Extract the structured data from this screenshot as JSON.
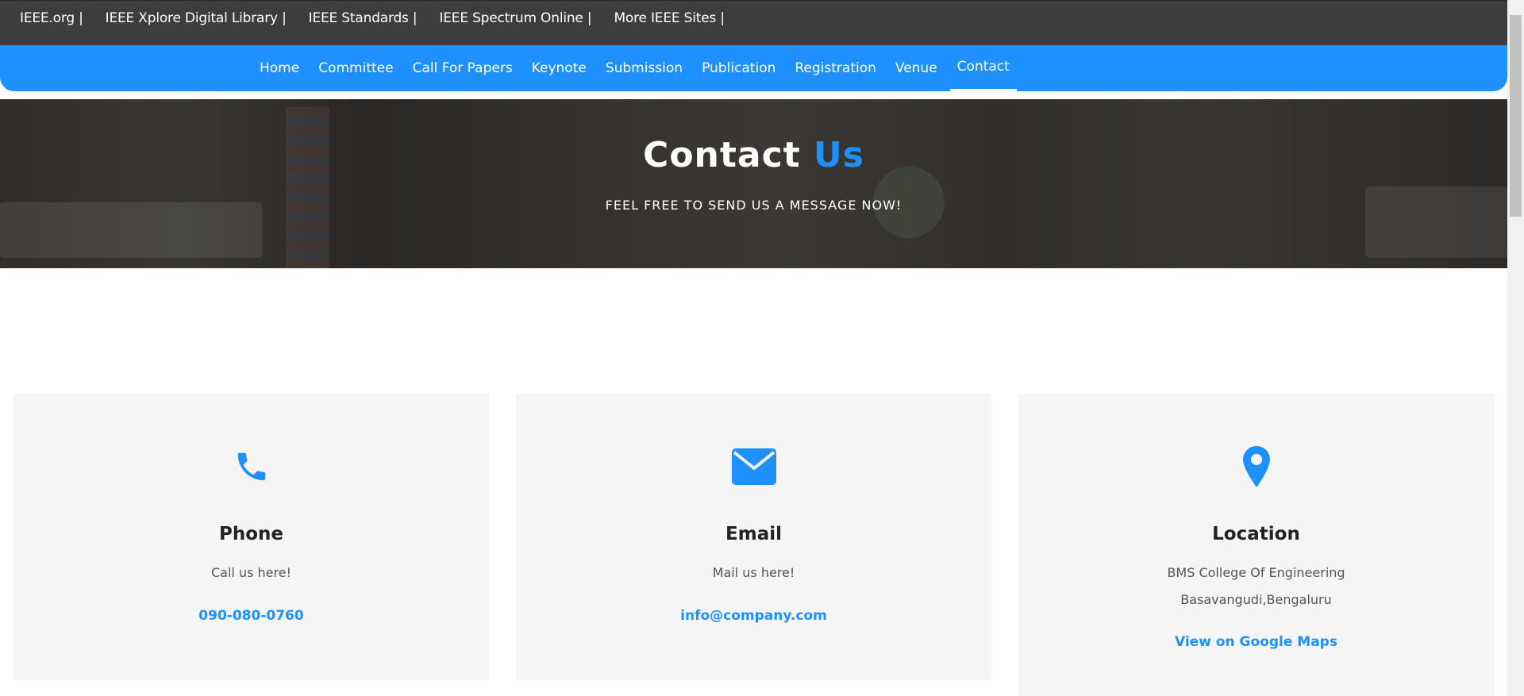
{
  "ieee_bar": {
    "links": [
      "IEEE.org |",
      "IEEE Xplore Digital Library |",
      "IEEE Standards |",
      "IEEE Spectrum Online |",
      "More IEEE Sites |"
    ]
  },
  "nav": {
    "items": [
      "Home",
      "Committee",
      "Call For Papers",
      "Keynote",
      "Submission",
      "Publication",
      "Registration",
      "Venue",
      "Contact"
    ],
    "active": "Contact"
  },
  "hero": {
    "title_main": "Contact",
    "title_accent": "Us",
    "subtitle": "FEEL FREE TO SEND US A MESSAGE NOW!"
  },
  "cards": {
    "phone": {
      "icon": "phone-icon",
      "title": "Phone",
      "text": "Call us here!",
      "link": "090-080-0760"
    },
    "email": {
      "icon": "envelope-icon",
      "title": "Email",
      "text": "Mail us here!",
      "link": "info@company.com"
    },
    "location": {
      "icon": "map-pin-icon",
      "title": "Location",
      "text_line1": "BMS College Of Engineering",
      "text_line2": "Basavangudi,Bengaluru",
      "link": "View on Google Maps"
    }
  },
  "colors": {
    "accent": "#1e90ff",
    "top_bar": "#3d3d3d",
    "card_bg": "#f5f5f5"
  }
}
